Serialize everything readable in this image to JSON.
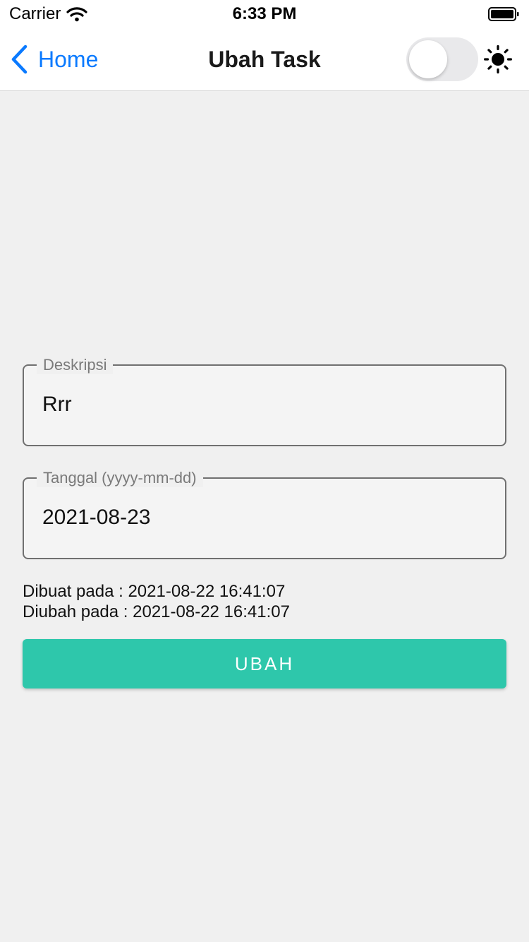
{
  "status_bar": {
    "carrier": "Carrier",
    "time": "6:33 PM"
  },
  "nav": {
    "back_label": "Home",
    "title": "Ubah Task",
    "theme_toggle_on": false
  },
  "form": {
    "description": {
      "label": "Deskripsi",
      "value": "Rrr"
    },
    "date": {
      "label": "Tanggal (yyyy-mm-dd)",
      "value": "2021-08-23"
    }
  },
  "meta": {
    "created": "Dibuat pada : 2021-08-22 16:41:07",
    "updated": "Diubah pada : 2021-08-22 16:41:07"
  },
  "submit_label": "UBAH",
  "colors": {
    "accent": "#2ec7ab",
    "link": "#0a7aff",
    "background": "#f0f0f0"
  }
}
